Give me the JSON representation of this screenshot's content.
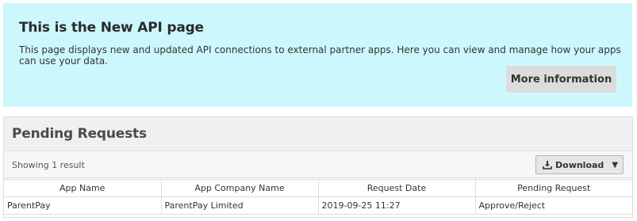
{
  "info": {
    "title": "This is the New API page",
    "description": "This page displays new and updated API connections to external partner apps. Here you can view and manage how your apps can use your data.",
    "more_info_label": "More information",
    "panel_color": "#ccf8fd"
  },
  "pending": {
    "title": "Pending Requests",
    "result_count": "Showing 1 result",
    "download_label": "Download",
    "download_icon": "download-icon",
    "columns": [
      "App Name",
      "App Company Name",
      "Request Date",
      "Pending Request"
    ],
    "rows": [
      [
        "ParentPay",
        "ParentPay Limited",
        "2019-09-25 11:27",
        "Approve/Reject"
      ]
    ]
  }
}
